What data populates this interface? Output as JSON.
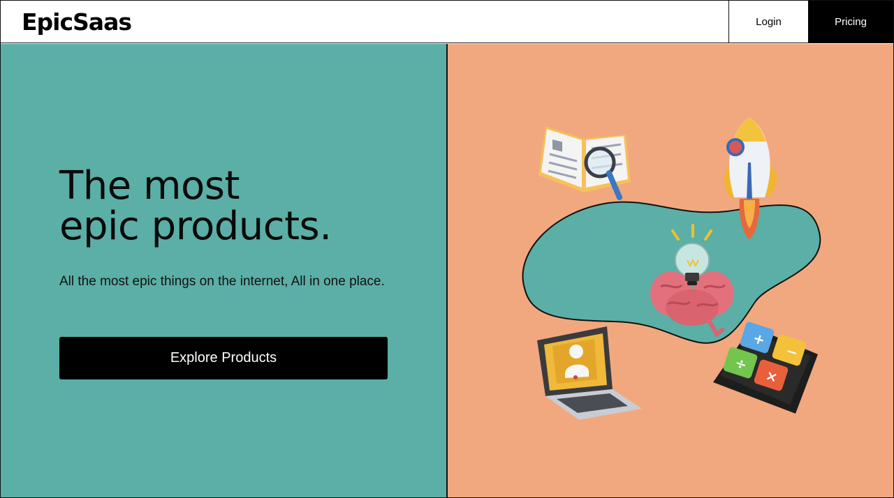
{
  "header": {
    "logo": "EpicSaas",
    "nav": {
      "login": "Login",
      "pricing": "Pricing"
    }
  },
  "hero": {
    "headline_line1": "The most",
    "headline_line2": "epic products.",
    "subtext": "All the most epic things on the internet, All in one place.",
    "cta_label": "Explore Products"
  },
  "colors": {
    "left_panel": "#5bafa6",
    "right_panel": "#f1a87e",
    "button": "#000000"
  },
  "illustration": {
    "icons": [
      "open-book-magnifier-icon",
      "rocket-icon",
      "brain-lightbulb-icon",
      "laptop-user-icon",
      "calculator-keys-icon"
    ]
  }
}
